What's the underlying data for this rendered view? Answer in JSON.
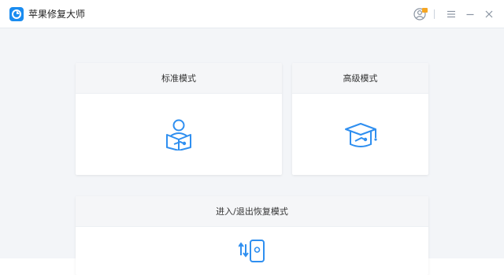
{
  "app": {
    "title": "苹果修复大师"
  },
  "modes": {
    "standard": {
      "label": "标准模式"
    },
    "advanced": {
      "label": "高级模式"
    },
    "recovery": {
      "label": "进入/退出恢复模式"
    }
  },
  "colors": {
    "accent": "#2f8ff0",
    "badge": "#f5a623"
  },
  "icons": {
    "user": "user-icon",
    "menu": "menu-icon",
    "minimize": "minimize-icon",
    "close": "close-icon"
  }
}
